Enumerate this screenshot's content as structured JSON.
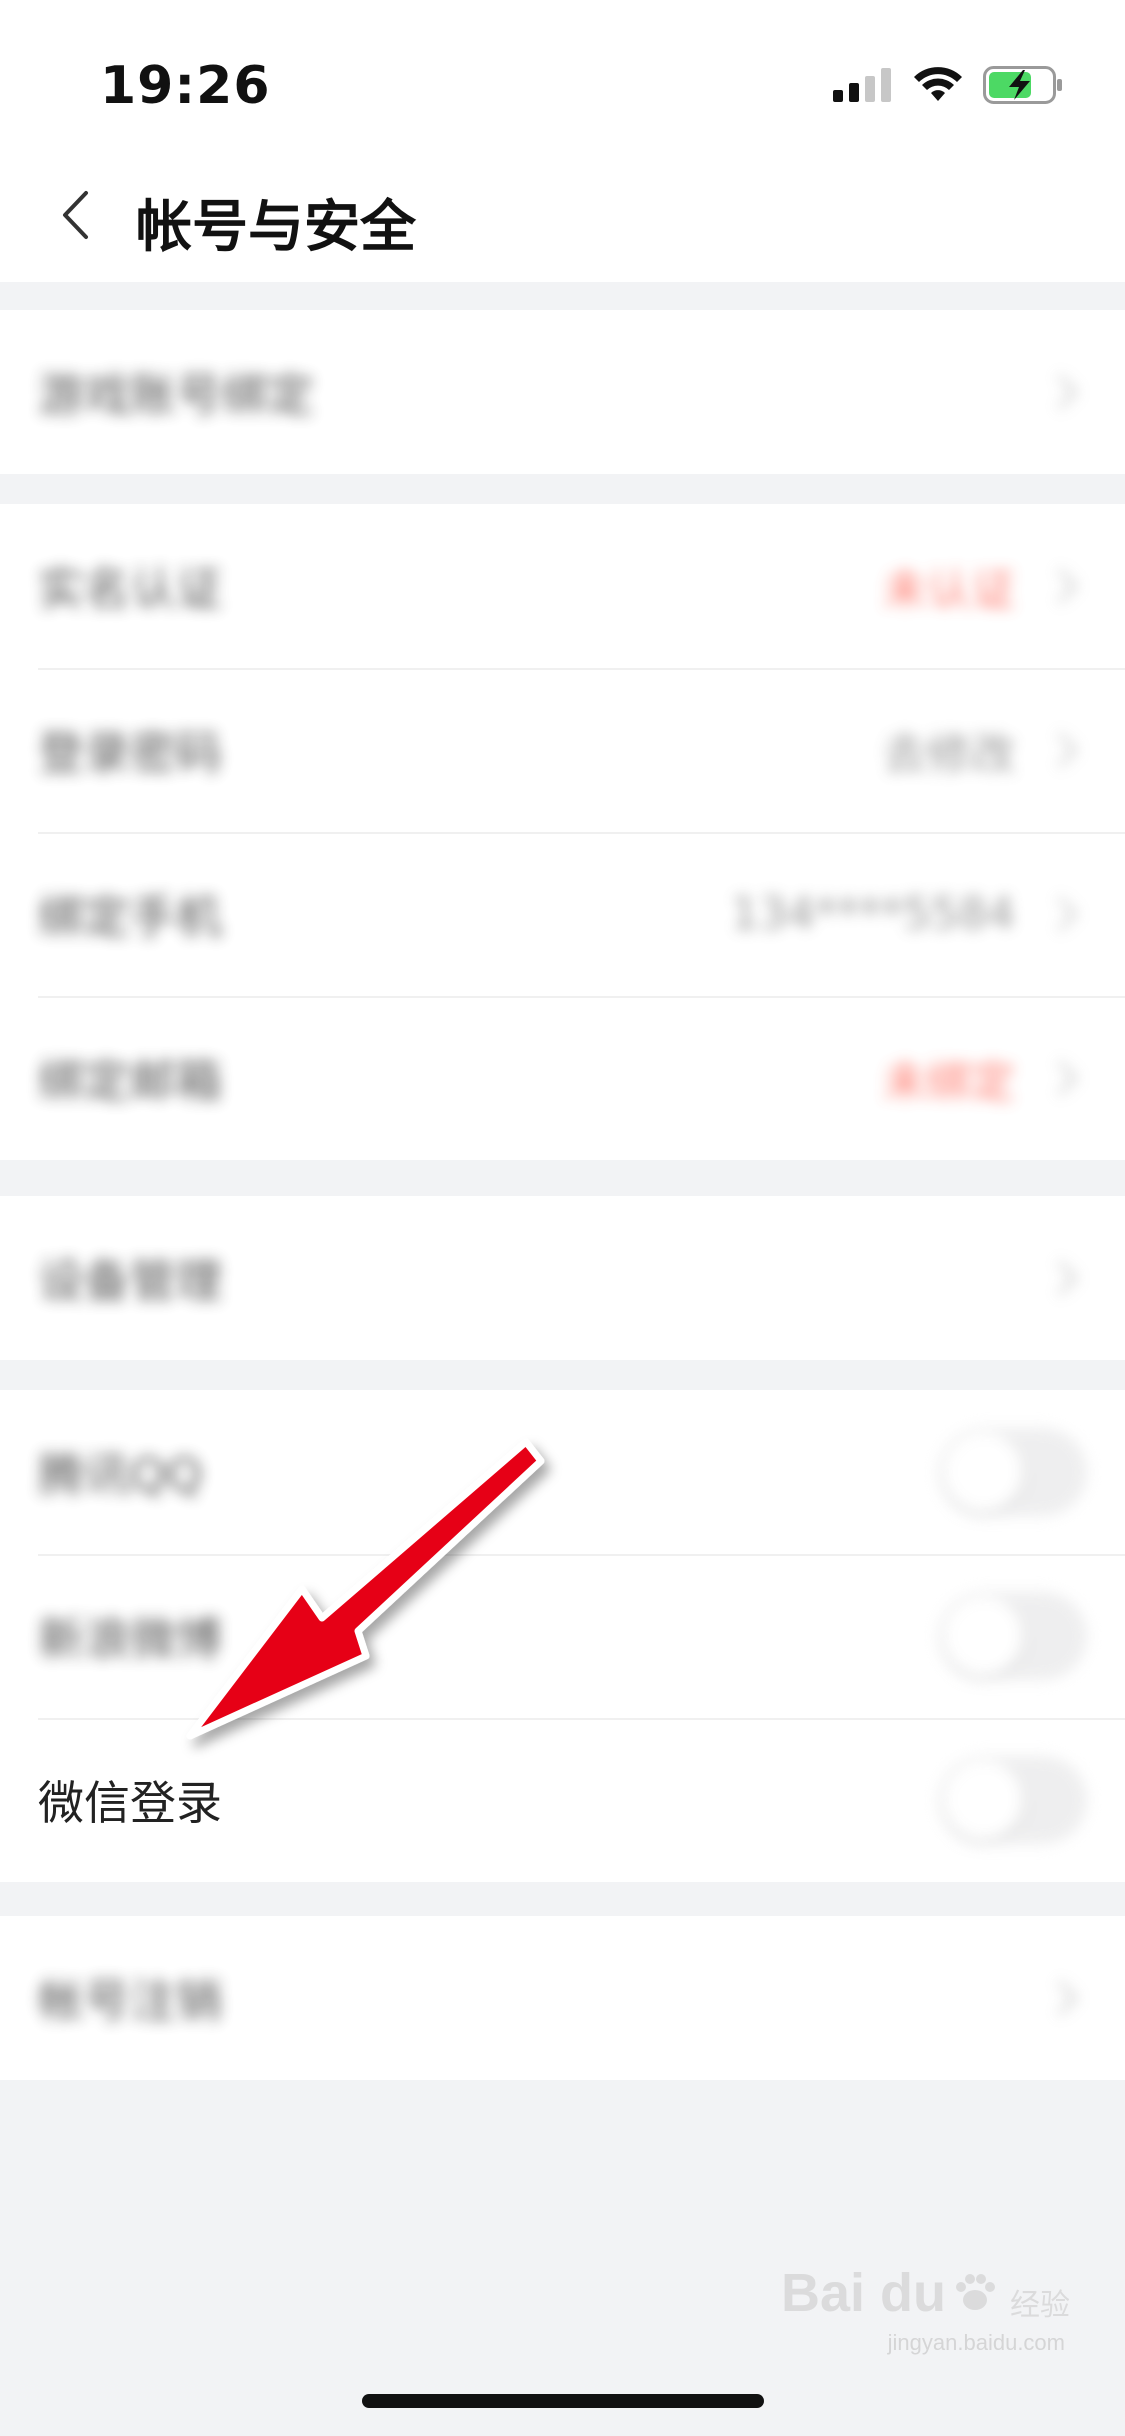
{
  "status_bar": {
    "time": "19:26",
    "icons": [
      "cellular-signal-icon",
      "wifi-icon",
      "battery-charging-icon"
    ]
  },
  "nav": {
    "back_icon": "chevron-left-icon",
    "title": "帐号与安全"
  },
  "sections": [
    {
      "rows": [
        {
          "label": "游戏账号绑定",
          "type": "link"
        }
      ]
    },
    {
      "rows": [
        {
          "label": "实名认证",
          "value": "未认证",
          "value_color": "#ff5a4a",
          "type": "link"
        },
        {
          "label": "登录密码",
          "value": "去修改",
          "type": "link"
        },
        {
          "label": "绑定手机",
          "value": "134****5584",
          "type": "link"
        },
        {
          "label": "绑定邮箱",
          "value": "未绑定",
          "value_color": "#ff5a4a",
          "type": "link"
        }
      ]
    },
    {
      "rows": [
        {
          "label": "设备管理",
          "type": "link"
        }
      ]
    },
    {
      "rows": [
        {
          "label": "腾讯QQ",
          "type": "toggle",
          "state": "off"
        },
        {
          "label": "新浪微博",
          "type": "toggle",
          "state": "off"
        },
        {
          "label": "微信登录",
          "type": "toggle",
          "state": "off"
        }
      ]
    },
    {
      "rows": [
        {
          "label": "帐号注销",
          "type": "link"
        }
      ]
    }
  ],
  "annotation": {
    "type": "red-arrow",
    "color": "#e60012"
  },
  "watermark": {
    "brand": "Bai du",
    "sub": "经验",
    "url": "jingyan.baidu.com"
  }
}
